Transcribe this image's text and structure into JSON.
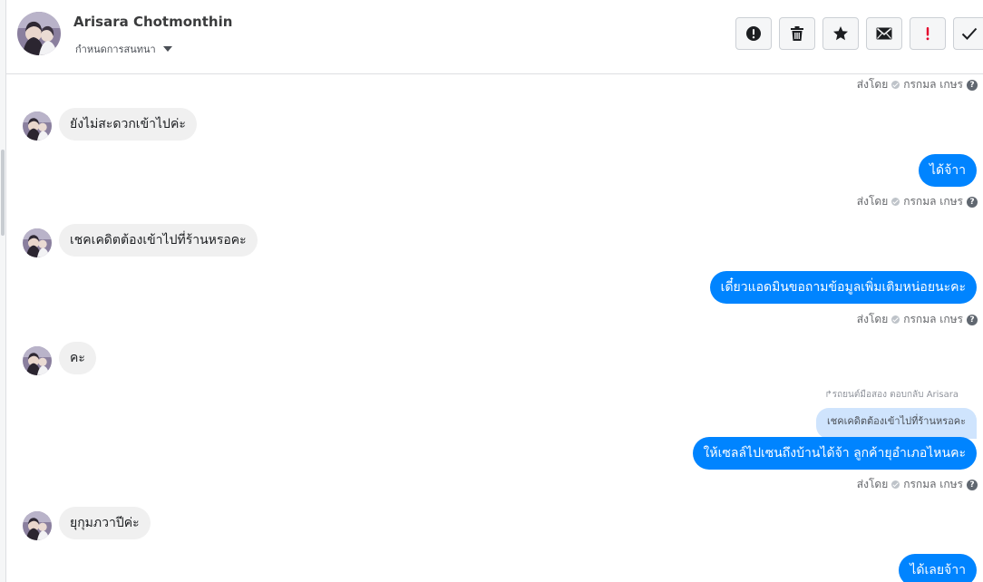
{
  "contact": {
    "name": "Arisara Chotmonthin",
    "assign_label": "กำหนดการสนทนา"
  },
  "toolbar": {
    "buttons": [
      {
        "icon": "alert-circle-icon"
      },
      {
        "icon": "trash-icon"
      },
      {
        "icon": "star-icon"
      },
      {
        "icon": "envelope-icon"
      },
      {
        "icon": "exclamation-icon"
      },
      {
        "icon": "checkmark-icon"
      }
    ]
  },
  "sent_by": {
    "prefix": "ส่งโดย",
    "name": "กรกมล เกษร",
    "help": "?"
  },
  "messages": [
    {
      "dir": "in",
      "text": "ยังไม่สะดวกเข้าไปค่ะ"
    },
    {
      "dir": "out",
      "text": "ได้จ้าา"
    },
    {
      "dir": "in",
      "text": "เชคเคดิตต้องเข้าไปที่ร้านหรอคะ"
    },
    {
      "dir": "out",
      "text": "เดี๋ยวแอดมินขอถามข้อมูลเพิ่มเติมหน่อยนะคะ"
    },
    {
      "dir": "in",
      "text": "คะ"
    },
    {
      "dir": "out",
      "text": "ให้เซลล์ไปเซนถึงบ้านได้จ้า ลูกค้ายุอำเภอไหนคะ"
    },
    {
      "dir": "in",
      "text": "ยุกุมภวาปีค่ะ"
    },
    {
      "dir": "out",
      "text": "ได้เลยจ้าา"
    }
  ],
  "reply": {
    "note": "รถยนต์มือสอง ตอบกลับ Arisara",
    "quoted_text": "เชคเคดิตต้องเข้าไปที่ร้านหรอคะ"
  },
  "colors": {
    "outgoing": "#0084ff",
    "incoming": "#f0f0f0",
    "quoted": "#cfe4fd",
    "alert_red": "#e4002b"
  }
}
